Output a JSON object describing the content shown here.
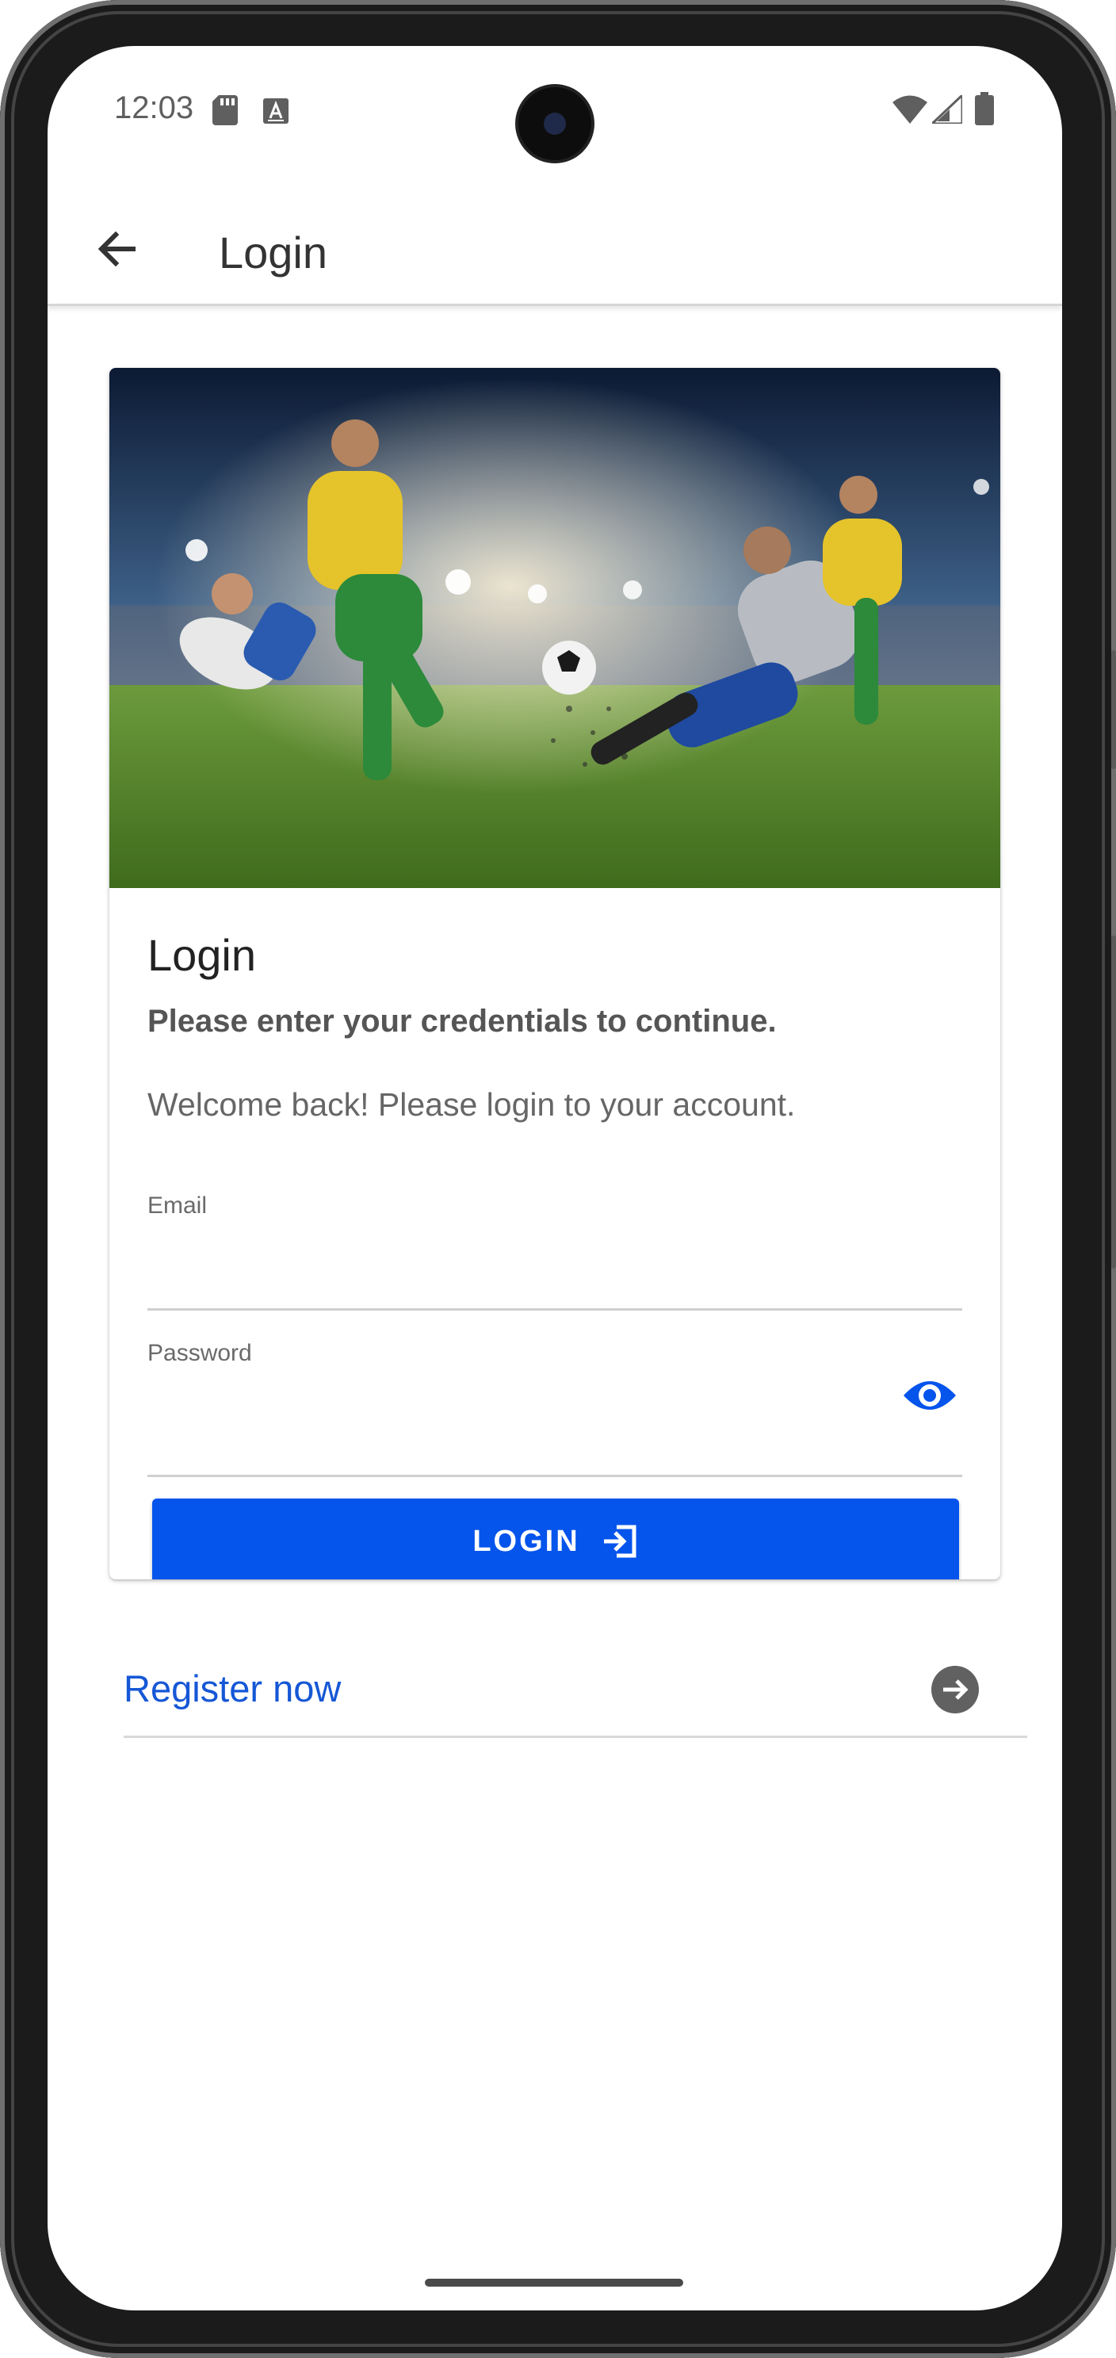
{
  "status_bar": {
    "time": "12:03",
    "icons": [
      "sd-card-icon",
      "keyboard-a-icon",
      "wifi-icon",
      "cell-signal-icon",
      "battery-icon"
    ]
  },
  "app_bar": {
    "title": "Login",
    "back_icon": "arrow-back-icon"
  },
  "card": {
    "image_description": "soccer players kicking a ball in a stadium",
    "title": "Login",
    "subtitle": "Please enter your credentials to continue.",
    "text": "Welcome back! Please login to your account.",
    "email": {
      "label": "Email",
      "value": "",
      "placeholder": ""
    },
    "password": {
      "label": "Password",
      "value": "",
      "placeholder": "",
      "toggle_icon": "eye-icon"
    },
    "login_button": {
      "label": "LOGIN",
      "icon": "login-icon"
    }
  },
  "register": {
    "label": "Register now",
    "icon": "arrow-circle-right-icon"
  },
  "colors": {
    "primary": "#0554ec",
    "link": "#1557d6",
    "text_primary": "#222222",
    "text_secondary": "#666666"
  }
}
